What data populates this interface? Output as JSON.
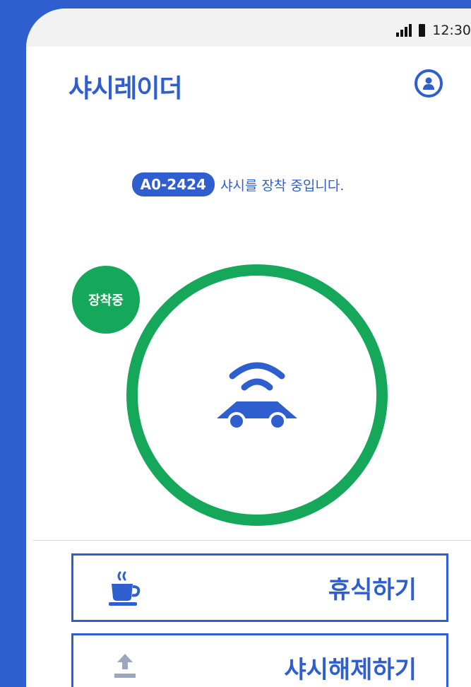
{
  "status_bar": {
    "time": "12:30"
  },
  "header": {
    "app_title": "샤시레이더"
  },
  "status": {
    "plate": "A0-2424",
    "message": "샤시를 장착 중입니다."
  },
  "mount": {
    "badge_label": "장착중",
    "ring_color": "#16a85a",
    "icon": "car-signal-icon"
  },
  "actions": [
    {
      "label": "휴식하기",
      "icon": "coffee-cup-icon"
    },
    {
      "label": "샤시해제하기",
      "icon": "upload-arrow-icon"
    }
  ],
  "colors": {
    "brand": "#2f5fcf",
    "accent": "#16a85a"
  }
}
